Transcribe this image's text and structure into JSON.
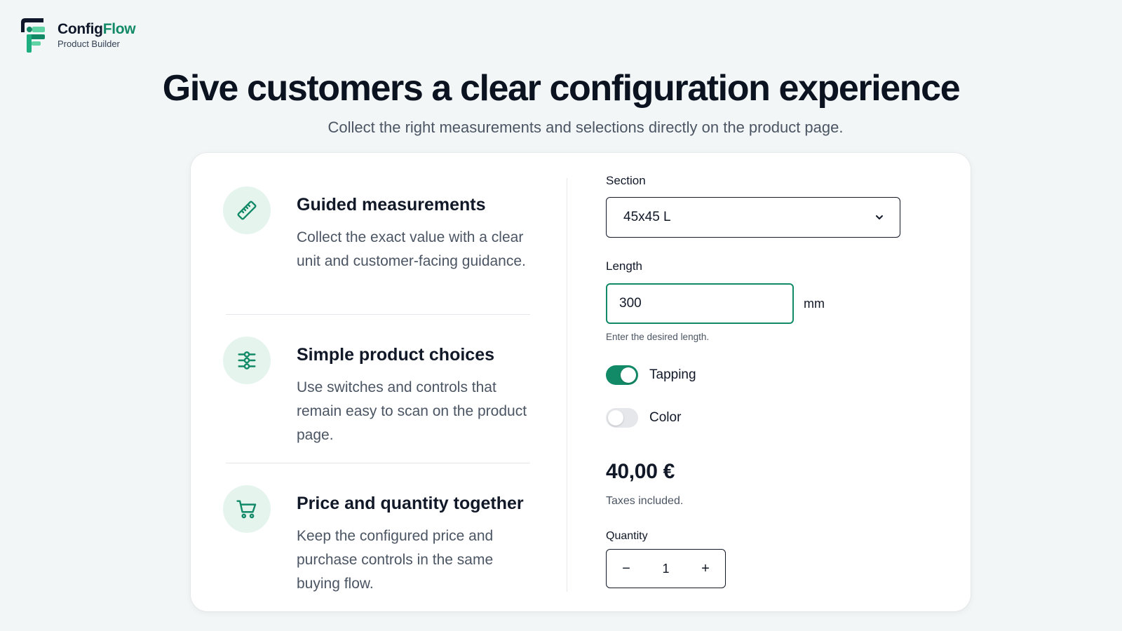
{
  "brand": {
    "name_part1": "Config",
    "name_part2": "Flow",
    "subtitle": "Product Builder",
    "accent_color": "#138a67"
  },
  "hero": {
    "title": "Give customers a clear configuration experience",
    "subtitle": "Collect the right measurements and selections directly on the product page."
  },
  "features": [
    {
      "icon": "ruler-icon",
      "title": "Guided measurements",
      "description": "Collect the exact value with a clear unit and customer-facing guidance."
    },
    {
      "icon": "sliders-icon",
      "title": "Simple product choices",
      "description": "Use switches and controls that remain easy to scan on the product page."
    },
    {
      "icon": "cart-icon",
      "title": "Price and quantity together",
      "description": "Keep the configured price and purchase controls in the same buying flow."
    }
  ],
  "form": {
    "section": {
      "label": "Section",
      "selected": "45x45 L"
    },
    "length": {
      "label": "Length",
      "value": "300",
      "unit": "mm",
      "help": "Enter the desired length."
    },
    "toggles": [
      {
        "label": "Tapping",
        "on": true
      },
      {
        "label": "Color",
        "on": false
      }
    ],
    "price": "40,00 €",
    "tax_note": "Taxes included.",
    "quantity": {
      "label": "Quantity",
      "value": "1",
      "minus": "−",
      "plus": "+"
    }
  }
}
